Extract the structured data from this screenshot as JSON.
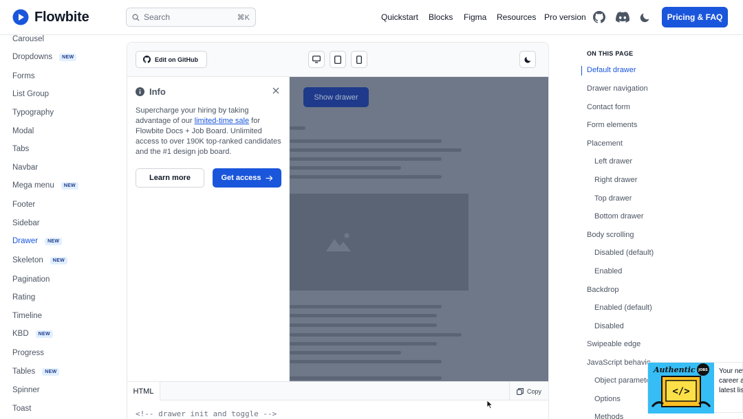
{
  "header": {
    "brand": "Flowbite",
    "search_placeholder": "Search",
    "search_shortcut": "⌘K",
    "nav": [
      "Quickstart",
      "Blocks",
      "Figma",
      "Resources",
      "Pro version"
    ],
    "cta": "Pricing & FAQ",
    "brand_color": "#1a56db"
  },
  "sidebar": {
    "items": [
      {
        "label": "Carousel",
        "badge": ""
      },
      {
        "label": "Dropdowns",
        "badge": "NEW"
      },
      {
        "label": "Forms",
        "badge": ""
      },
      {
        "label": "List Group",
        "badge": ""
      },
      {
        "label": "Typography",
        "badge": ""
      },
      {
        "label": "Modal",
        "badge": ""
      },
      {
        "label": "Tabs",
        "badge": ""
      },
      {
        "label": "Navbar",
        "badge": ""
      },
      {
        "label": "Mega menu",
        "badge": "NEW"
      },
      {
        "label": "Footer",
        "badge": ""
      },
      {
        "label": "Sidebar",
        "badge": ""
      },
      {
        "label": "Drawer",
        "badge": "NEW",
        "active": true
      },
      {
        "label": "Skeleton",
        "badge": "NEW"
      },
      {
        "label": "Pagination",
        "badge": ""
      },
      {
        "label": "Rating",
        "badge": ""
      },
      {
        "label": "Timeline",
        "badge": ""
      },
      {
        "label": "KBD",
        "badge": "NEW"
      },
      {
        "label": "Progress",
        "badge": ""
      },
      {
        "label": "Tables",
        "badge": "NEW"
      },
      {
        "label": "Spinner",
        "badge": ""
      },
      {
        "label": "Toast",
        "badge": ""
      }
    ]
  },
  "preview": {
    "github_button": "Edit on GitHub",
    "show_drawer": "Show drawer",
    "drawer": {
      "title": "Info",
      "text_before": "Supercharge your hiring by taking advantage of our ",
      "link": "limited-time sale",
      "text_after": " for Flowbite Docs + Job Board. Unlimited access to over 190K top-ranked candidates and the #1 design job board.",
      "learn_more": "Learn more",
      "get_access": "Get access"
    },
    "code_tab": "HTML",
    "copy": "Copy",
    "code_line": "<!-- drawer init and toggle -->"
  },
  "toc": {
    "title": "ON THIS PAGE",
    "items": [
      {
        "label": "Default drawer",
        "level": 0,
        "active": true
      },
      {
        "label": "Drawer navigation",
        "level": 0
      },
      {
        "label": "Contact form",
        "level": 0
      },
      {
        "label": "Form elements",
        "level": 0
      },
      {
        "label": "Placement",
        "level": 0
      },
      {
        "label": "Left drawer",
        "level": 1
      },
      {
        "label": "Right drawer",
        "level": 1
      },
      {
        "label": "Top drawer",
        "level": 1
      },
      {
        "label": "Bottom drawer",
        "level": 1
      },
      {
        "label": "Body scrolling",
        "level": 0
      },
      {
        "label": "Disabled (default)",
        "level": 1
      },
      {
        "label": "Enabled",
        "level": 1
      },
      {
        "label": "Backdrop",
        "level": 0
      },
      {
        "label": "Enabled (default)",
        "level": 1
      },
      {
        "label": "Disabled",
        "level": 1
      },
      {
        "label": "Swipeable edge",
        "level": 0
      },
      {
        "label": "JavaScript behavio",
        "level": 0
      },
      {
        "label": "Object paramete",
        "level": 1
      },
      {
        "label": "Options",
        "level": 1
      },
      {
        "label": "Methods",
        "level": 1
      }
    ]
  },
  "ad": {
    "lines": [
      "Your nev",
      "career a",
      "latest lis"
    ],
    "image_text": "Authentic",
    "image_badge": "JOBS"
  }
}
